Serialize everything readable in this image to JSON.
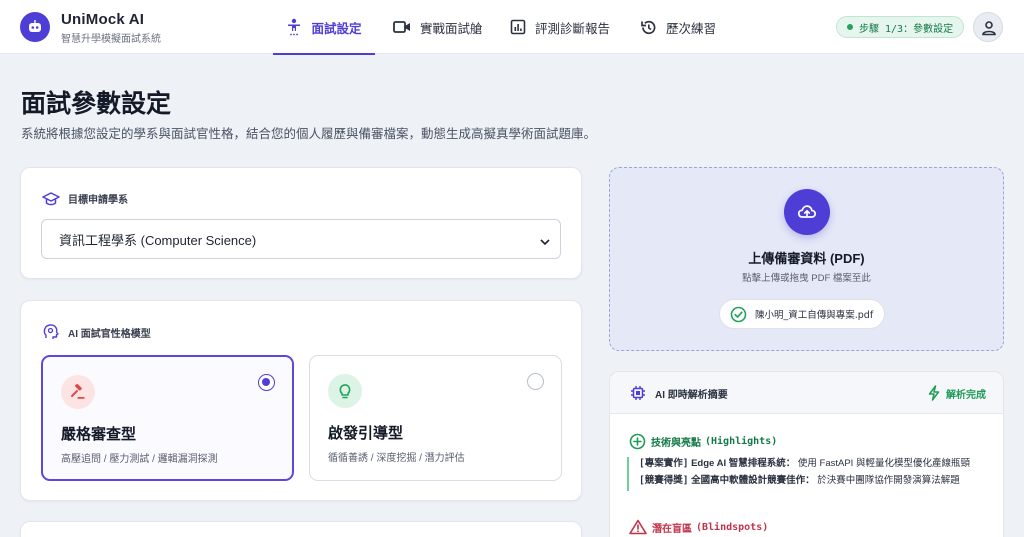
{
  "header": {
    "app_title": "UniMock AI",
    "app_subtitle": "智慧升學模擬面試系統",
    "logo_icon": "robot-icon",
    "tabs": [
      {
        "label": "面試設定",
        "icon": "person-icon",
        "active": true
      },
      {
        "label": "實戰面試艙",
        "icon": "video-icon",
        "active": false
      },
      {
        "label": "評測診斷報告",
        "icon": "chart-icon",
        "active": false
      },
      {
        "label": "歷次練習",
        "icon": "history-icon",
        "active": false
      }
    ],
    "step_badge": "步驟 1/3：參數設定",
    "user_icon": "user-icon"
  },
  "page": {
    "title": "面試參數設定",
    "description": "系統將根據您設定的學系與面試官性格，結合您的個人履歷與備審檔案，動態生成高擬真學術面試題庫。"
  },
  "department": {
    "label": "目標申請學系",
    "selected": "資訊工程學系 (Computer Science)"
  },
  "interviewer": {
    "label": "AI 面試官性格模型",
    "options": [
      {
        "title": "嚴格審查型",
        "tags": "高壓追問 / 壓力測試 / 邏輯漏洞探測",
        "selected": true,
        "color": "#e04848"
      },
      {
        "title": "啟發引導型",
        "tags": "循循善誘 / 深度挖掘 / 潛力評估",
        "selected": false,
        "color": "#22a45d"
      }
    ]
  },
  "upload": {
    "title": "上傳備審資料 (PDF)",
    "hint": "點擊上傳或拖曳 PDF 檔案至此",
    "file_name": "陳小明_資工自傳與專案.pdf"
  },
  "summary": {
    "title": "AI 即時解析摘要",
    "status": "解析完成",
    "highlights_title": "技術與亮點",
    "highlights_en": "(Highlights)",
    "highlights": [
      {
        "tag": "[專案實作]",
        "key": "Edge AI 智慧排程系統：",
        "text": "使用 FastAPI 與輕量化模型優化產線瓶頸"
      },
      {
        "tag": "[競賽得獎]",
        "key": "全國高中軟體設計競賽佳作：",
        "text": "於決賽中團隊協作開發演算法解題"
      }
    ],
    "blindspots_title": "潛在盲區",
    "blindspots_en": "(Blindspots)"
  },
  "colors": {
    "accent": "#4f3ed6",
    "success": "#22a45d",
    "danger": "#c2334a"
  }
}
